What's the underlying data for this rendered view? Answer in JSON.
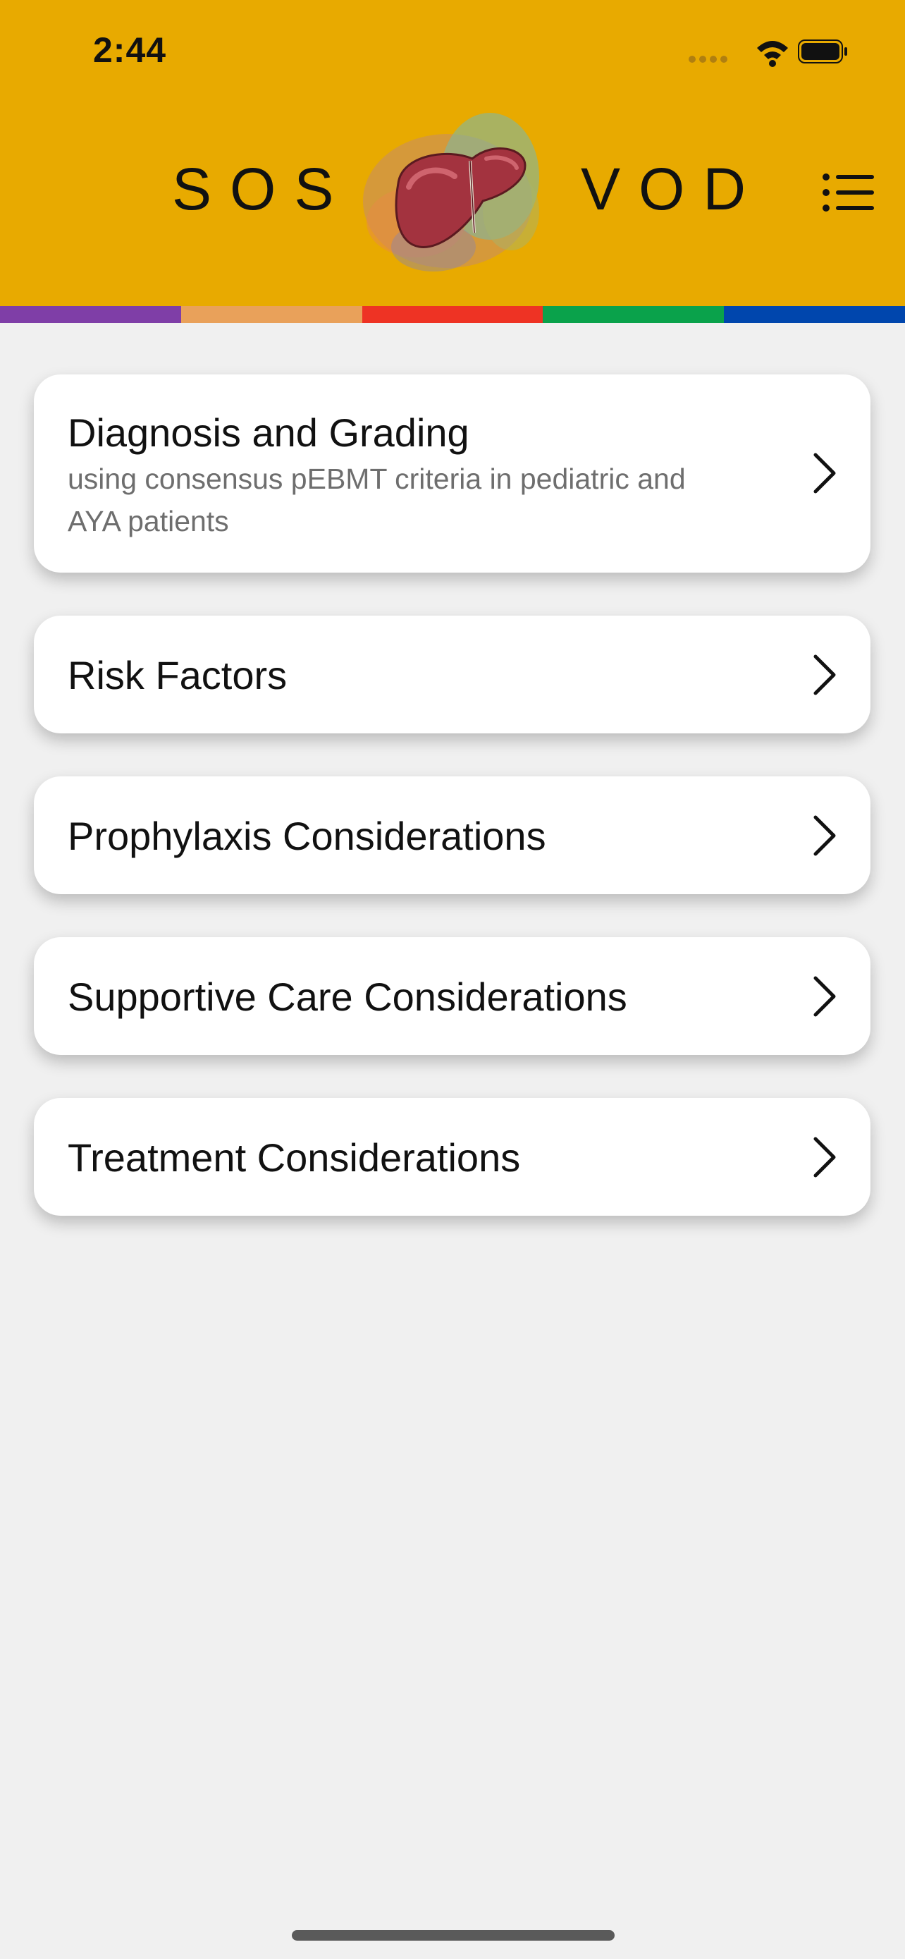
{
  "status_bar": {
    "time": "2:44",
    "icons": [
      "signal-dots-icon",
      "wifi-icon",
      "battery-icon"
    ]
  },
  "header": {
    "brand_left": "SOS",
    "brand_right": "VOD",
    "logo": "liver-logo-icon",
    "menu_icon": "list-menu-icon",
    "background_color": "#e8aa00",
    "color_bar": [
      "#7f3ea7",
      "#e9a15a",
      "#ee3324",
      "#0aa24b",
      "#0046ad"
    ]
  },
  "menu": {
    "items": [
      {
        "title": "Diagnosis and Grading",
        "subtitle": "using consensus pEBMT criteria in pediatric and AYA patients"
      },
      {
        "title": "Risk Factors"
      },
      {
        "title": "Prophylaxis Considerations"
      },
      {
        "title": "Supportive Care Considerations"
      },
      {
        "title": "Treatment Considerations"
      }
    ]
  }
}
